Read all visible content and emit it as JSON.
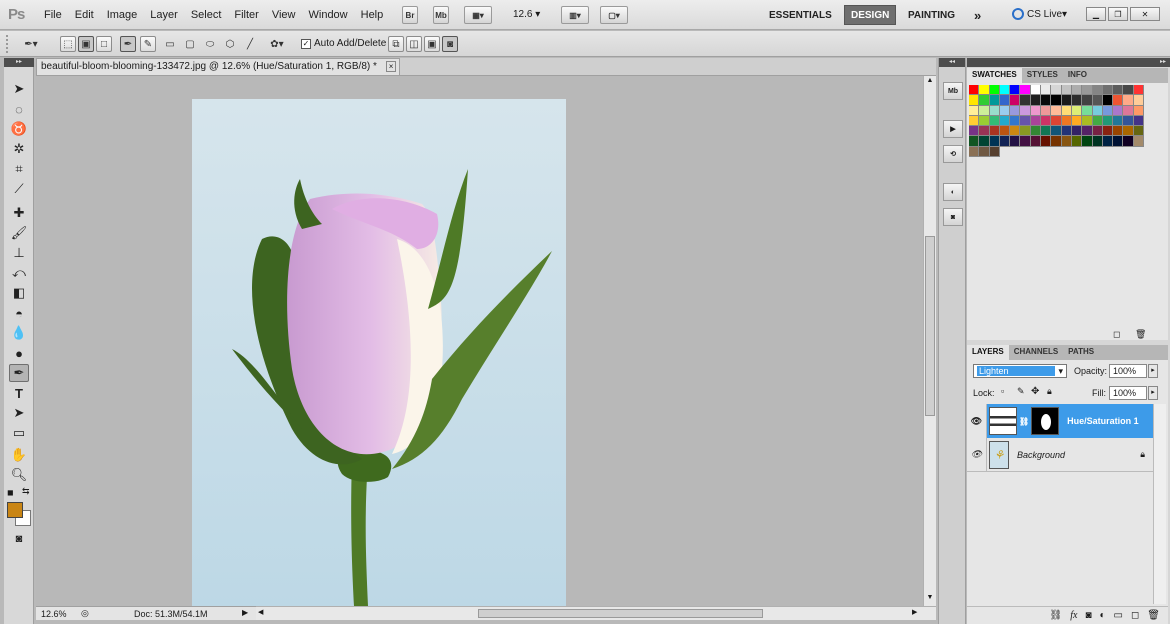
{
  "app": {
    "logo": "Ps"
  },
  "menu": [
    "File",
    "Edit",
    "Image",
    "Layer",
    "Select",
    "Filter",
    "View",
    "Window",
    "Help"
  ],
  "appbar": {
    "bridge": "Br",
    "minibridge": "Mb",
    "zoom": "12.6"
  },
  "workspaces": [
    "ESSENTIALS",
    "DESIGN",
    "PAINTING"
  ],
  "workspace_overflow": "»",
  "cs_live": "CS Live",
  "options": {
    "auto_add_delete": "Auto Add/Delete",
    "auto_add_checked": true
  },
  "document": {
    "tab_title": "beautiful-bloom-blooming-133472.jpg @ 12.6% (Hue/Saturation 1, RGB/8) *",
    "close": "×"
  },
  "status": {
    "zoom": "12.6%",
    "doc": "Doc: 51.3M/54.1M"
  },
  "colors": {
    "foreground": "#c98514",
    "background": "#ffffff",
    "accent": "#3d9be9"
  },
  "swatch_panel": {
    "tabs": [
      "SWATCHES",
      "STYLES",
      "INFO"
    ],
    "active": "SWATCHES"
  },
  "layers_panel": {
    "tabs": [
      "LAYERS",
      "CHANNELS",
      "PATHS"
    ],
    "active": "LAYERS",
    "blend_mode": "Lighten",
    "opacity_label": "Opacity:",
    "opacity": "100%",
    "lock_label": "Lock:",
    "fill_label": "Fill:",
    "fill": "100%",
    "layers": [
      {
        "name": "Hue/Saturation 1",
        "selected": true,
        "visible": true
      },
      {
        "name": "Background",
        "selected": false,
        "visible": true,
        "locked": true
      }
    ]
  }
}
